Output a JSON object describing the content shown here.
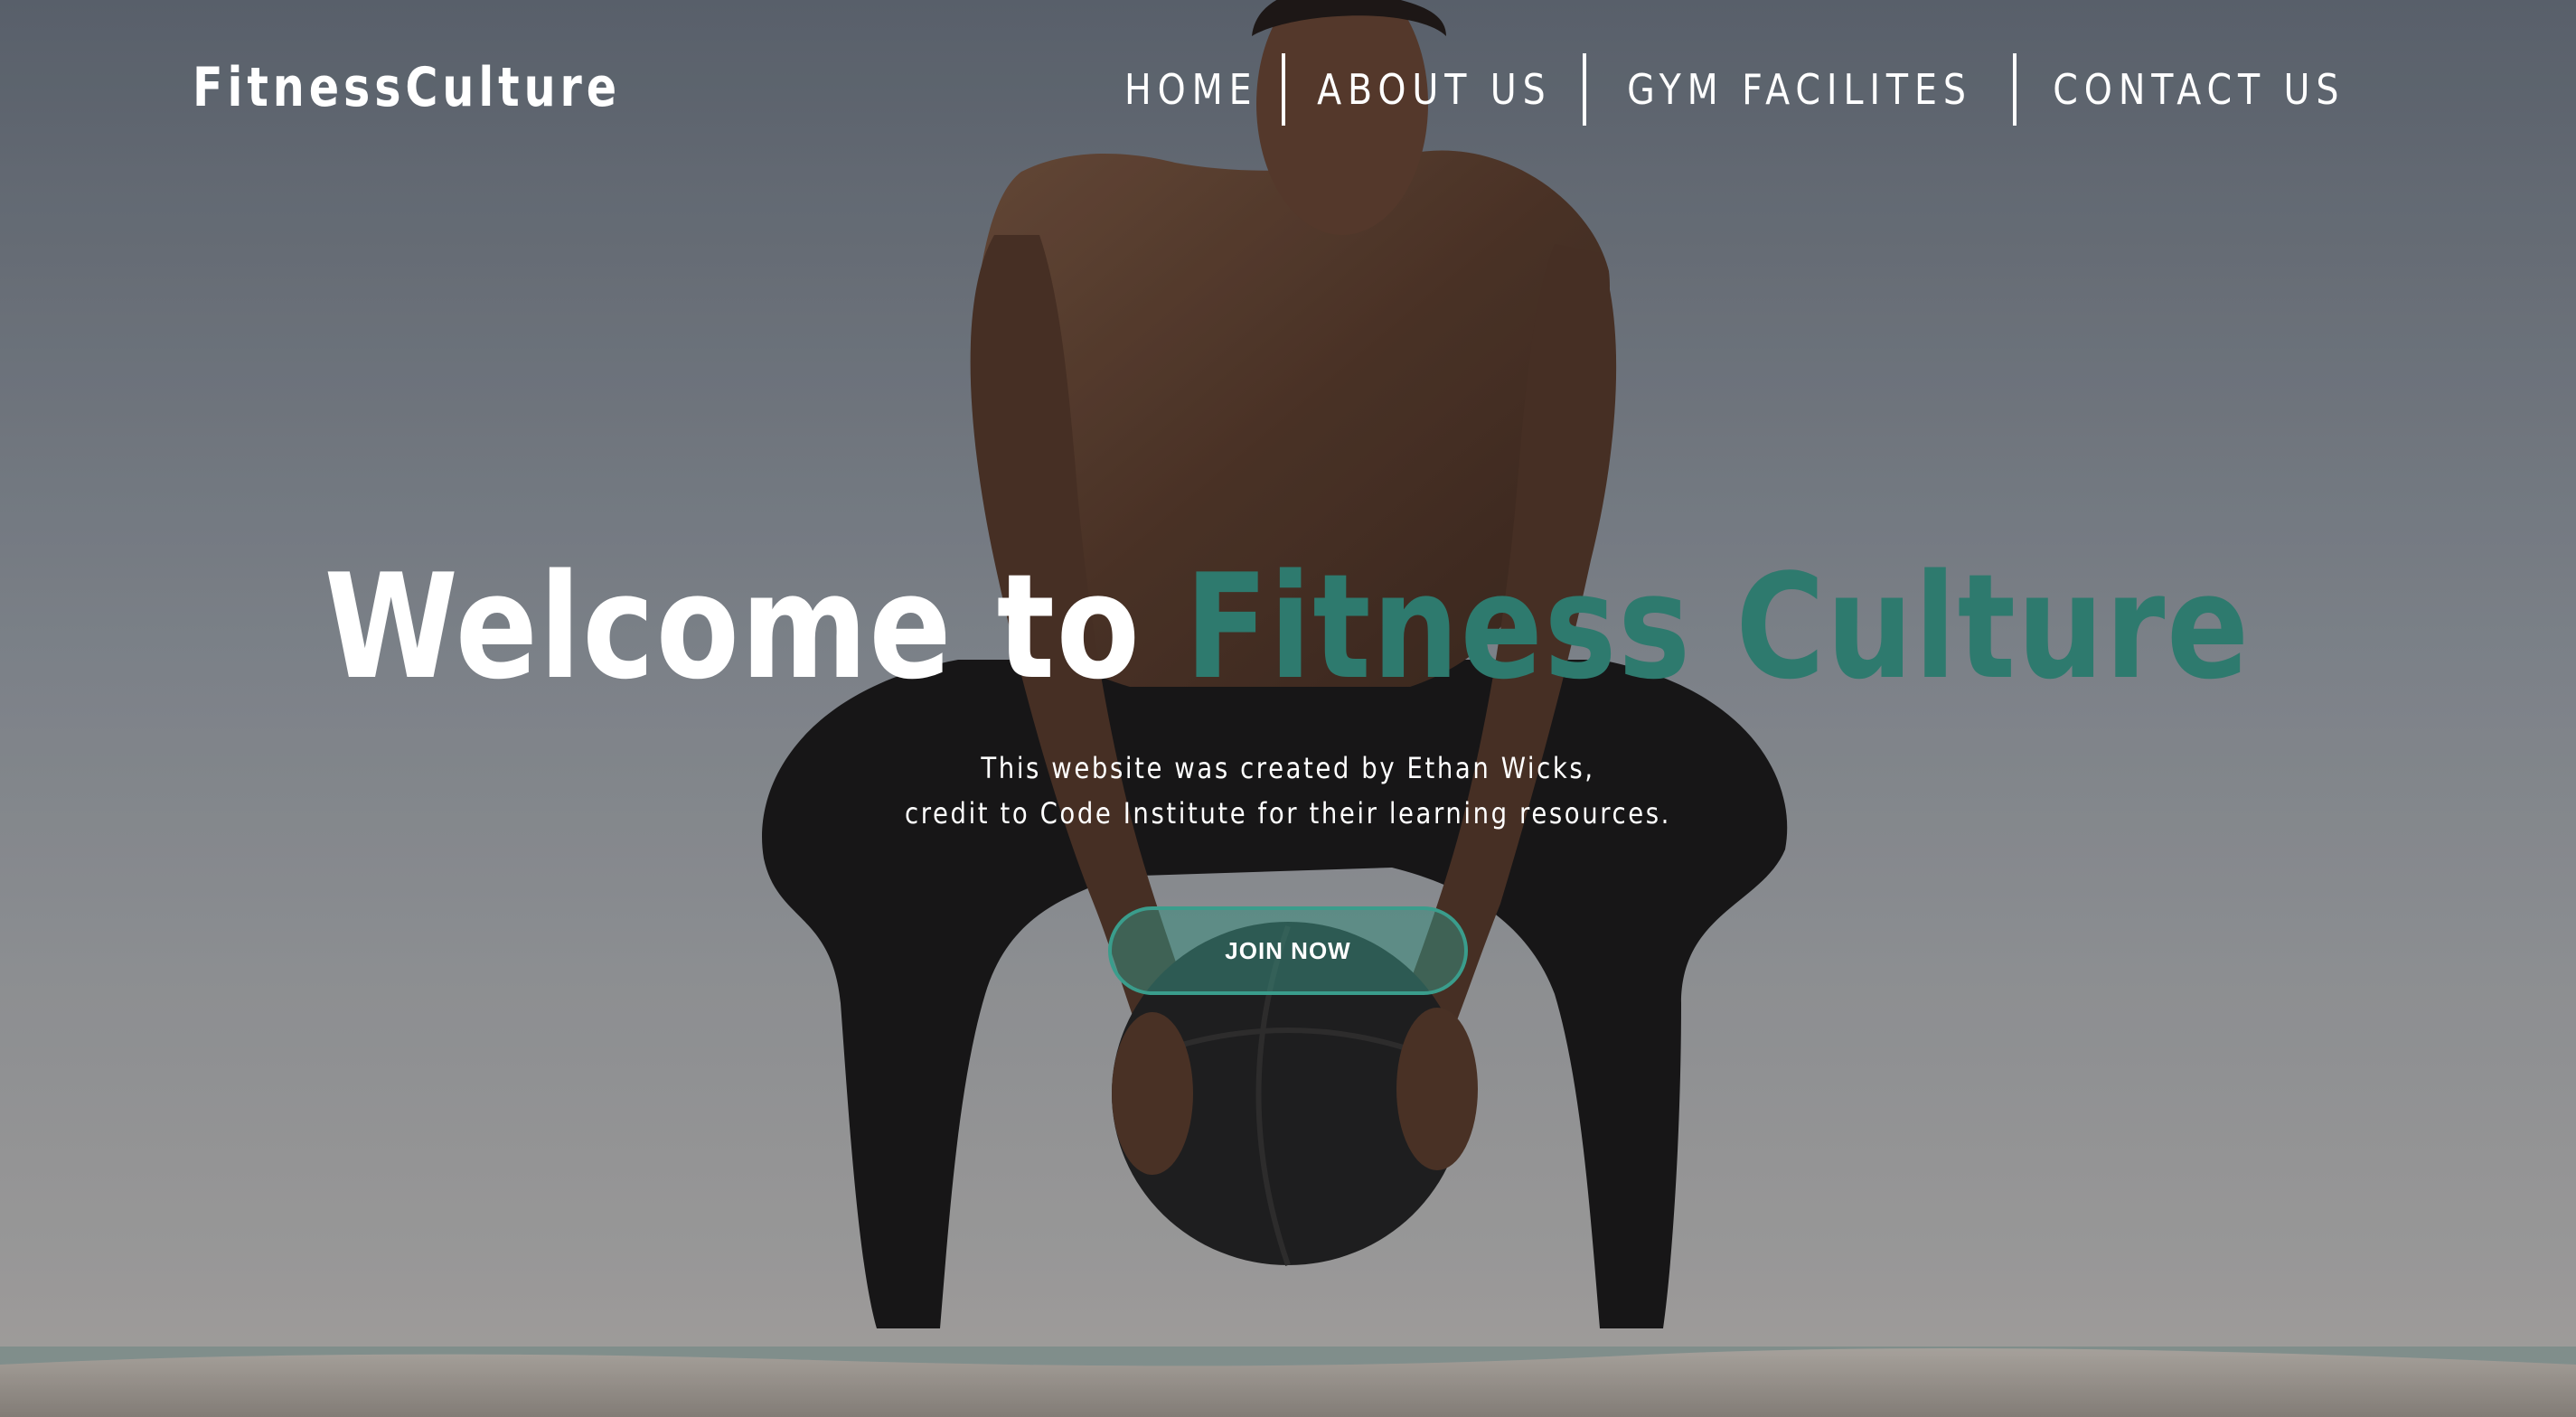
{
  "header": {
    "brand": "FitnessCulture",
    "nav": [
      {
        "label": "HOME"
      },
      {
        "label": "ABOUT US"
      },
      {
        "label": "GYM FACILITES"
      },
      {
        "label": "CONTACT US"
      }
    ]
  },
  "hero": {
    "headline_prefix": "Welcome to",
    "headline_accent": "Fitness Culture",
    "credit_line_1": "This website was created by Ethan Wicks,",
    "credit_line_2": "credit to Code Institute for their learning resources.",
    "join_button": "JOIN NOW"
  },
  "colors": {
    "accent": "#2e7a6e",
    "button_border": "#3a9d8c",
    "text": "#ffffff"
  }
}
